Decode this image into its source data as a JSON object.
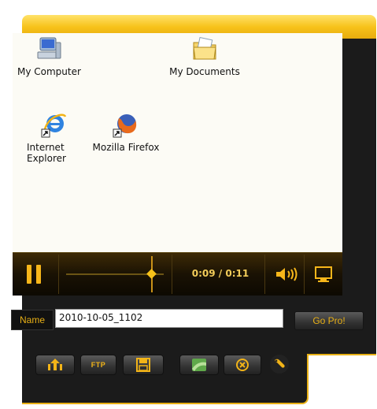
{
  "desktop": {
    "icons": [
      {
        "label": "My Computer",
        "icon": "my-computer-icon"
      },
      {
        "label": "My Documents",
        "icon": "my-documents-icon"
      },
      {
        "label_line1": "Internet",
        "label_line2": "Explorer",
        "icon": "internet-explorer-icon"
      },
      {
        "label": "Mozilla Firefox",
        "icon": "mozilla-firefox-icon"
      }
    ]
  },
  "player": {
    "timecode": "0:09 / 0:11",
    "progress_fraction": 0.82
  },
  "name_row": {
    "label": "Name",
    "value": "2010-10-05_1102",
    "go_pro_label": "Go Pro!"
  },
  "toolbar": {
    "ftp_label": "FTP",
    "buttons": [
      "upload-icon",
      "ftp-button",
      "save-icon",
      "screencast-icon",
      "cancel-icon",
      "settings-icon"
    ]
  },
  "colors": {
    "accent": "#f7c21a",
    "frame_dark": "#1b1b1b",
    "timecode": "#f2cc5a"
  }
}
